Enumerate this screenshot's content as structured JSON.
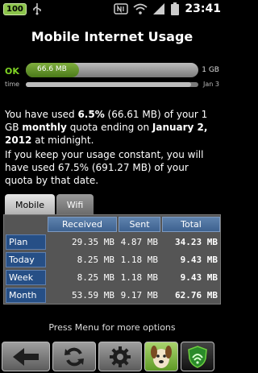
{
  "status_bar": {
    "battery_badge": "100",
    "time": "23:41",
    "icons": [
      "usb-icon",
      "nfc-icon",
      "wifi-icon",
      "signal-icon",
      "battery-icon"
    ]
  },
  "title": "Mobile Internet Usage",
  "usage_bar": {
    "status": "OK",
    "used_label": "66.6 MB",
    "limit_label": "1 GB",
    "fraction": 0.065,
    "color": "#6da536"
  },
  "time_bar": {
    "label": "time",
    "end_label": "Jan 3",
    "fraction": 0.96
  },
  "summary": {
    "p1_a": "You have used ",
    "p1_pct": "6.5%",
    "p1_b": " (66.61 MB) of your 1 GB ",
    "p1_period": "monthly",
    "p1_c": " quota ending on ",
    "p1_date": "January 2, 2012",
    "p1_d": " at midnight.",
    "p2": "If you keep your usage constant, you will have used 67.5% (691.27 MB) of your quota by that date."
  },
  "tabs": [
    {
      "label": "Mobile",
      "selected": true
    },
    {
      "label": "Wifi",
      "selected": false
    }
  ],
  "table": {
    "headers": [
      "Received",
      "Sent",
      "Total"
    ],
    "rows": [
      {
        "label": "Plan",
        "received": "29.35 MB",
        "sent": "4.87 MB",
        "total": "34.23 MB"
      },
      {
        "label": "Today",
        "received": "8.25 MB",
        "sent": "1.18 MB",
        "total": "9.43 MB"
      },
      {
        "label": "Week",
        "received": "8.25 MB",
        "sent": "1.18 MB",
        "total": "9.43 MB"
      },
      {
        "label": "Month",
        "received": "53.59 MB",
        "sent": "9.17 MB",
        "total": "62.76 MB"
      }
    ]
  },
  "footer_hint": "Press Menu for more options",
  "bottom_buttons": [
    "back-arrow-icon",
    "refresh-icon",
    "settings-icon",
    "app-dog-icon",
    "shield-icon"
  ]
}
